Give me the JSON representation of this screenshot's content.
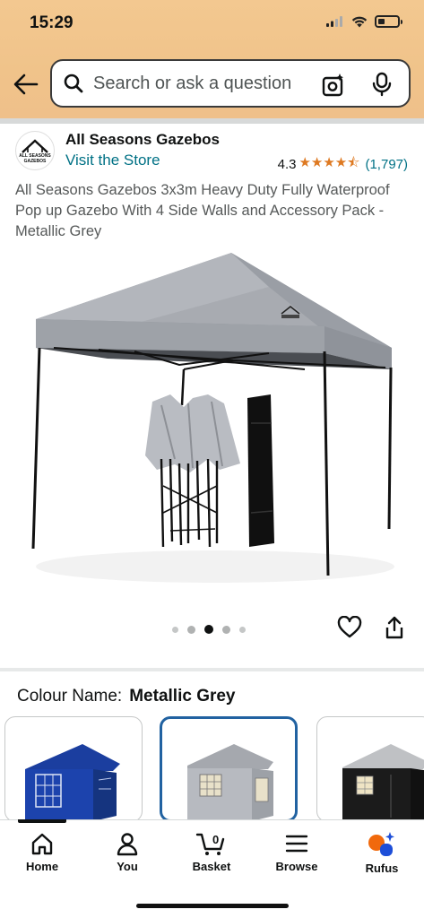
{
  "status_bar": {
    "time": "15:29"
  },
  "search": {
    "placeholder": "Search or ask a question"
  },
  "brand": {
    "name": "All Seasons Gazebos",
    "store_link": "Visit the Store",
    "logo_text": [
      "ALL SEASONS",
      "GAZEBOS"
    ]
  },
  "rating": {
    "value": "4.3",
    "stars": "★★★★⯪",
    "count": "(1,797)"
  },
  "product": {
    "title": "All Seasons Gazebos 3x3m Heavy Duty Fully Waterproof Pop up Gazebo With 4 Side Walls and Accessory Pack - Metallic Grey",
    "carousel": {
      "count": 5,
      "active_index": 2
    }
  },
  "colour": {
    "label": "Colour Name:",
    "value": "Metallic Grey"
  },
  "swatches": [
    {
      "color": "#1a3c9a",
      "name": "blue"
    },
    {
      "color": "#b9bcc1",
      "name": "metallic-grey",
      "selected": true
    },
    {
      "color": "#1b1b1b",
      "name": "black"
    }
  ],
  "tabs": [
    {
      "label": "Home",
      "icon": "home-icon"
    },
    {
      "label": "You",
      "icon": "person-icon"
    },
    {
      "label": "Basket",
      "icon": "basket-icon",
      "badge": "0"
    },
    {
      "label": "Browse",
      "icon": "menu-icon"
    },
    {
      "label": "Rufus",
      "icon": "rufus-icon"
    }
  ],
  "colors": {
    "header": "#f0c38a",
    "link": "#007185",
    "star": "#de7921",
    "selected_border": "#2162a1"
  }
}
